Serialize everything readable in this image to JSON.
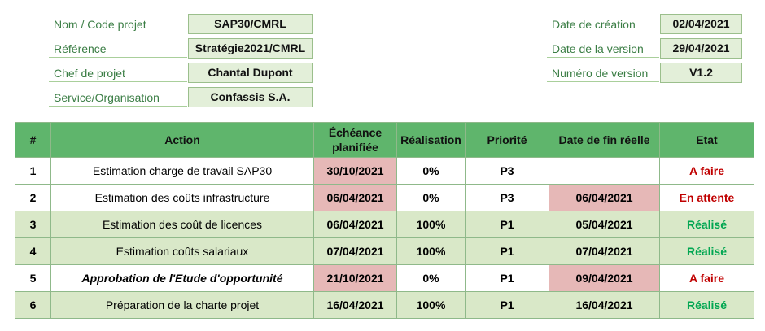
{
  "project_info": {
    "nom_label": "Nom / Code projet",
    "nom_value": "SAP30/CMRL",
    "ref_label": "Référence",
    "ref_value": "Stratégie2021/CMRL",
    "chef_label": "Chef de projet",
    "chef_value": "Chantal Dupont",
    "service_label": "Service/Organisation",
    "service_value": "Confassis S.A."
  },
  "version_info": {
    "creation_label": "Date de création",
    "creation_value": "02/04/2021",
    "version_date_label": "Date de la version",
    "version_date_value": "29/04/2021",
    "version_num_label": "Numéro de version",
    "version_num_value": "V1.2"
  },
  "table": {
    "headers": [
      "#",
      "Action",
      "Échéance\nplanifiée",
      "Réalisation",
      "Priorité",
      "Date de fin réelle",
      "Etat"
    ],
    "rows": [
      {
        "num": "1",
        "action": "Estimation charge de travail SAP30",
        "echeance": "30/10/2021",
        "realisation": "0%",
        "priorite": "P3",
        "fin": "",
        "etat": "A faire"
      },
      {
        "num": "2",
        "action": "Estimation des coûts infrastructure",
        "echeance": "06/04/2021",
        "realisation": "0%",
        "priorite": "P3",
        "fin": "06/04/2021",
        "etat": "En attente"
      },
      {
        "num": "3",
        "action": "Estimation des coût de licences",
        "echeance": "06/04/2021",
        "realisation": "100%",
        "priorite": "P1",
        "fin": "05/04/2021",
        "etat": "Réalisé"
      },
      {
        "num": "4",
        "action": "Estimation coûts salariaux",
        "echeance": "07/04/2021",
        "realisation": "100%",
        "priorite": "P1",
        "fin": "07/04/2021",
        "etat": "Réalisé"
      },
      {
        "num": "5",
        "action": "Approbation de l'Etude d'opportunité",
        "echeance": "21/10/2021",
        "realisation": "0%",
        "priorite": "P1",
        "fin": "09/04/2021",
        "etat": "A faire"
      },
      {
        "num": "6",
        "action": "Préparation de la charte projet",
        "echeance": "16/04/2021",
        "realisation": "100%",
        "priorite": "P1",
        "fin": "16/04/2021",
        "etat": "Réalisé"
      }
    ]
  },
  "colors": {
    "header_green": "#5fb56c",
    "done_row": "#d9e8c8",
    "overdue_pink": "#e6b8b7",
    "status_red": "#c00000",
    "status_green": "#00a651"
  }
}
